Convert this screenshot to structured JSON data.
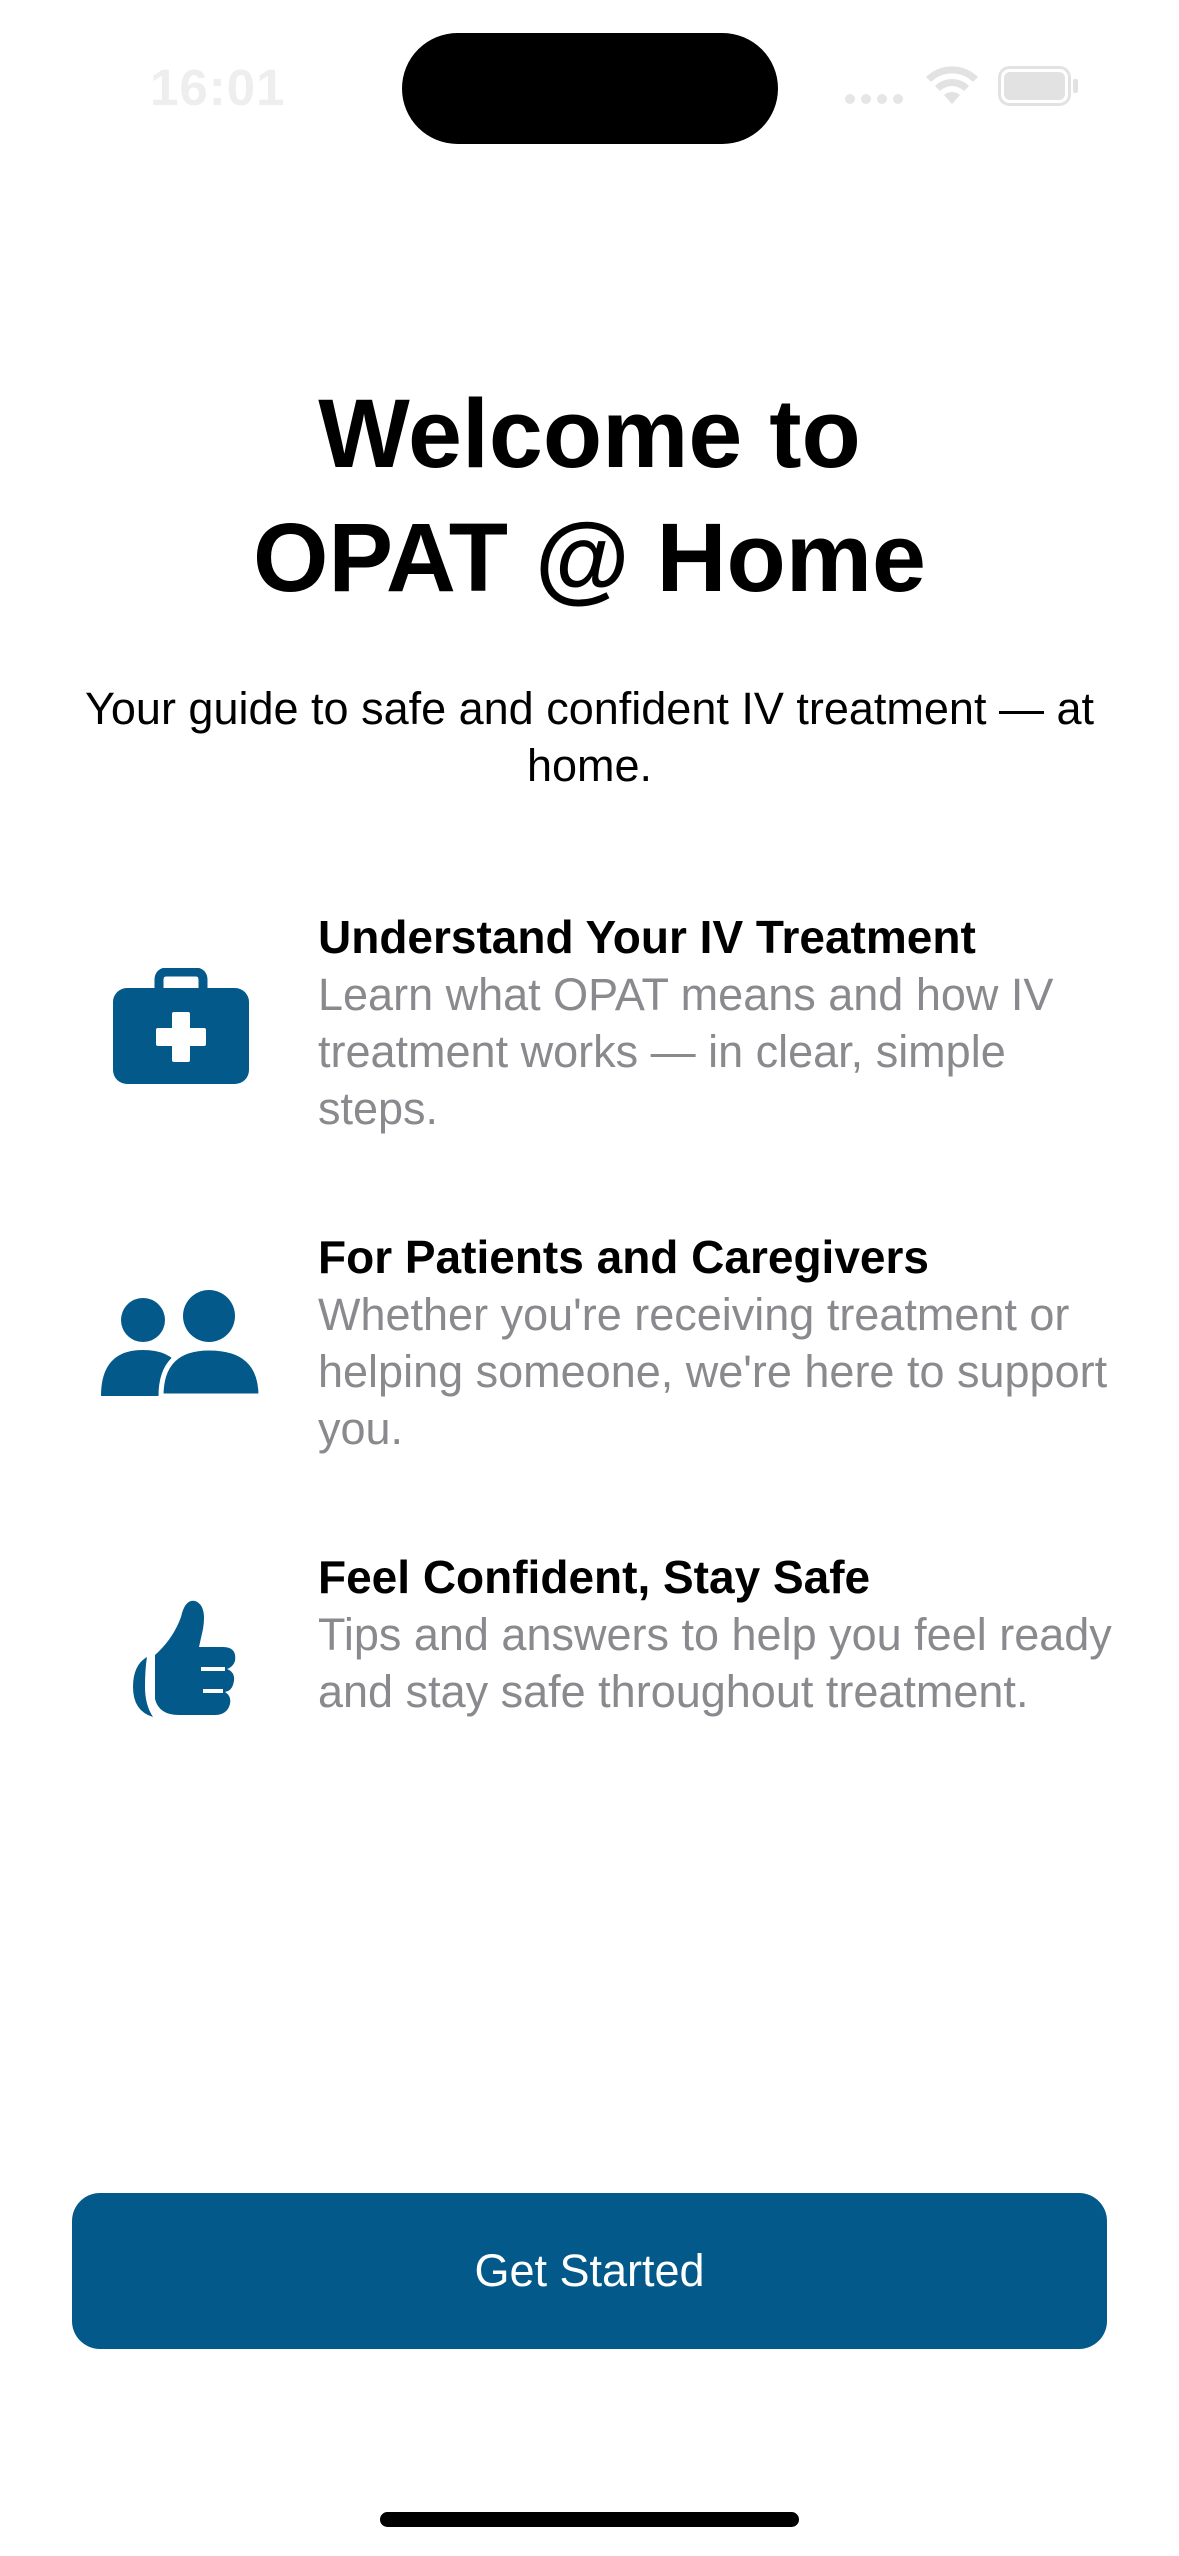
{
  "status_bar": {
    "time": "16:01",
    "icons": [
      "signal-dots-icon",
      "wifi-icon",
      "battery-icon"
    ]
  },
  "welcome": {
    "title_line1": "Welcome to",
    "title_line2": "OPAT @ Home",
    "subtitle": "Your guide to safe and confident IV treatment — at home."
  },
  "features": [
    {
      "icon": "medical-kit-icon",
      "title": "Understand Your IV Treatment",
      "description": "Learn what OPAT means and how IV treatment works — in clear, simple steps."
    },
    {
      "icon": "people-icon",
      "title": "For Patients and Caregivers",
      "description": "Whether you're receiving treatment or helping someone, we're here to support you."
    },
    {
      "icon": "thumbs-up-icon",
      "title": "Feel Confident, Stay Safe",
      "description": "Tips and answers to help you feel ready and stay safe throughout treatment."
    }
  ],
  "cta": {
    "label": "Get Started"
  },
  "colors": {
    "accent": "#035a8a",
    "secondary_text": "#8a8a8e",
    "background": "#ffffff"
  }
}
